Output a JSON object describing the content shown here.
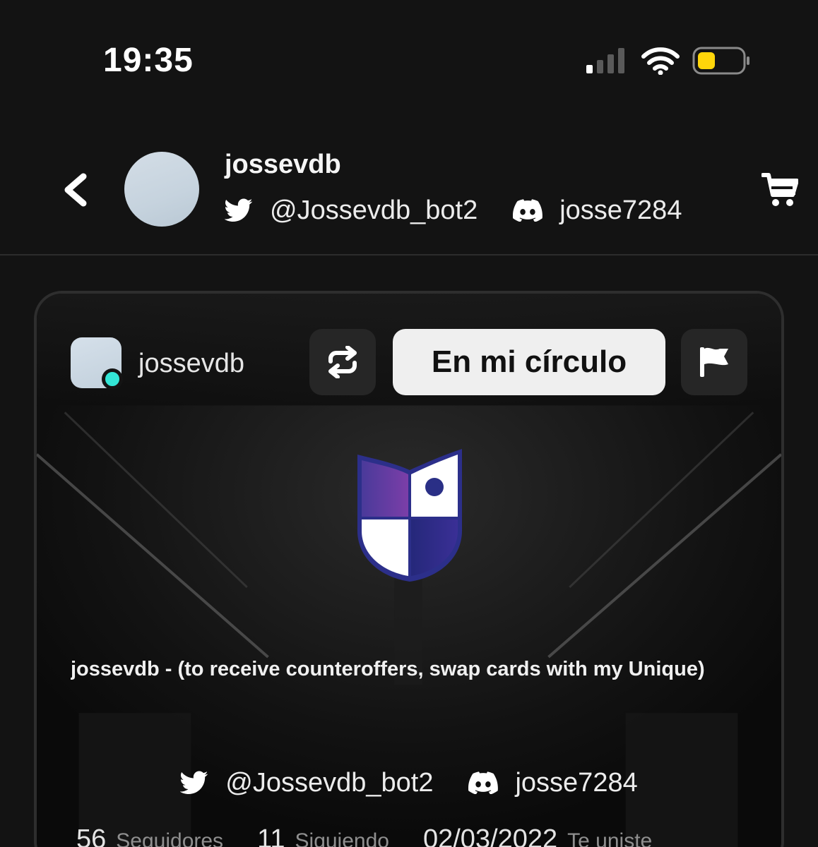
{
  "status_bar": {
    "time": "19:35",
    "icons": [
      "signal-icon",
      "wifi-icon",
      "battery-icon"
    ],
    "battery_color": "#ffd60a"
  },
  "header": {
    "back_icon": "chevron-left-icon",
    "name": "jossevdb",
    "twitter_handle": "@Jossevdb_bot2",
    "discord_handle": "josse7284",
    "cart_icon": "cart-icon"
  },
  "card": {
    "username": "jossevdb",
    "online_color": "#33e6d6",
    "repost_icon": "repost-icon",
    "circle_button_label": "En mi círculo",
    "flag_icon": "flag-icon",
    "logo_colors": {
      "purple": "#5b3aa0",
      "navy": "#2a2f86",
      "white": "#ffffff"
    },
    "bio": "jossevdb -  (to receive counteroffers, swap cards with my Unique)",
    "twitter_handle": "@Jossevdb_bot2",
    "discord_handle": "josse7284",
    "stats": [
      {
        "value": "56",
        "label": "Seguidores"
      },
      {
        "value": "11",
        "label": "Siguiendo"
      },
      {
        "value": "02/03/2022",
        "label": "Te uniste"
      }
    ]
  }
}
